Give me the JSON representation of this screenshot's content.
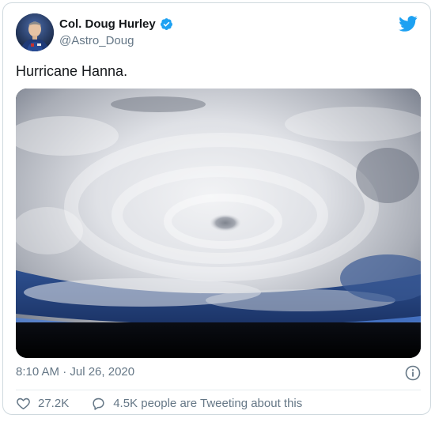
{
  "author": {
    "display_name": "Col. Doug Hurley",
    "handle": "@Astro_Doug",
    "verified": true
  },
  "tweet": {
    "text": "Hurricane Hanna.",
    "timestamp": "8:10 AM · Jul 26, 2020"
  },
  "engagement": {
    "likes": "27.2K",
    "replies_text": "4.5K people are Tweeting about this"
  },
  "colors": {
    "brand_blue": "#1da1f2",
    "secondary_text": "#657786",
    "primary_text": "#14171a",
    "border": "#cfd9de"
  },
  "icons": {
    "verified": "verified-badge-icon",
    "brand": "twitter-bird-icon",
    "info": "info-icon",
    "like": "heart-icon",
    "reply": "speech-bubble-icon"
  }
}
